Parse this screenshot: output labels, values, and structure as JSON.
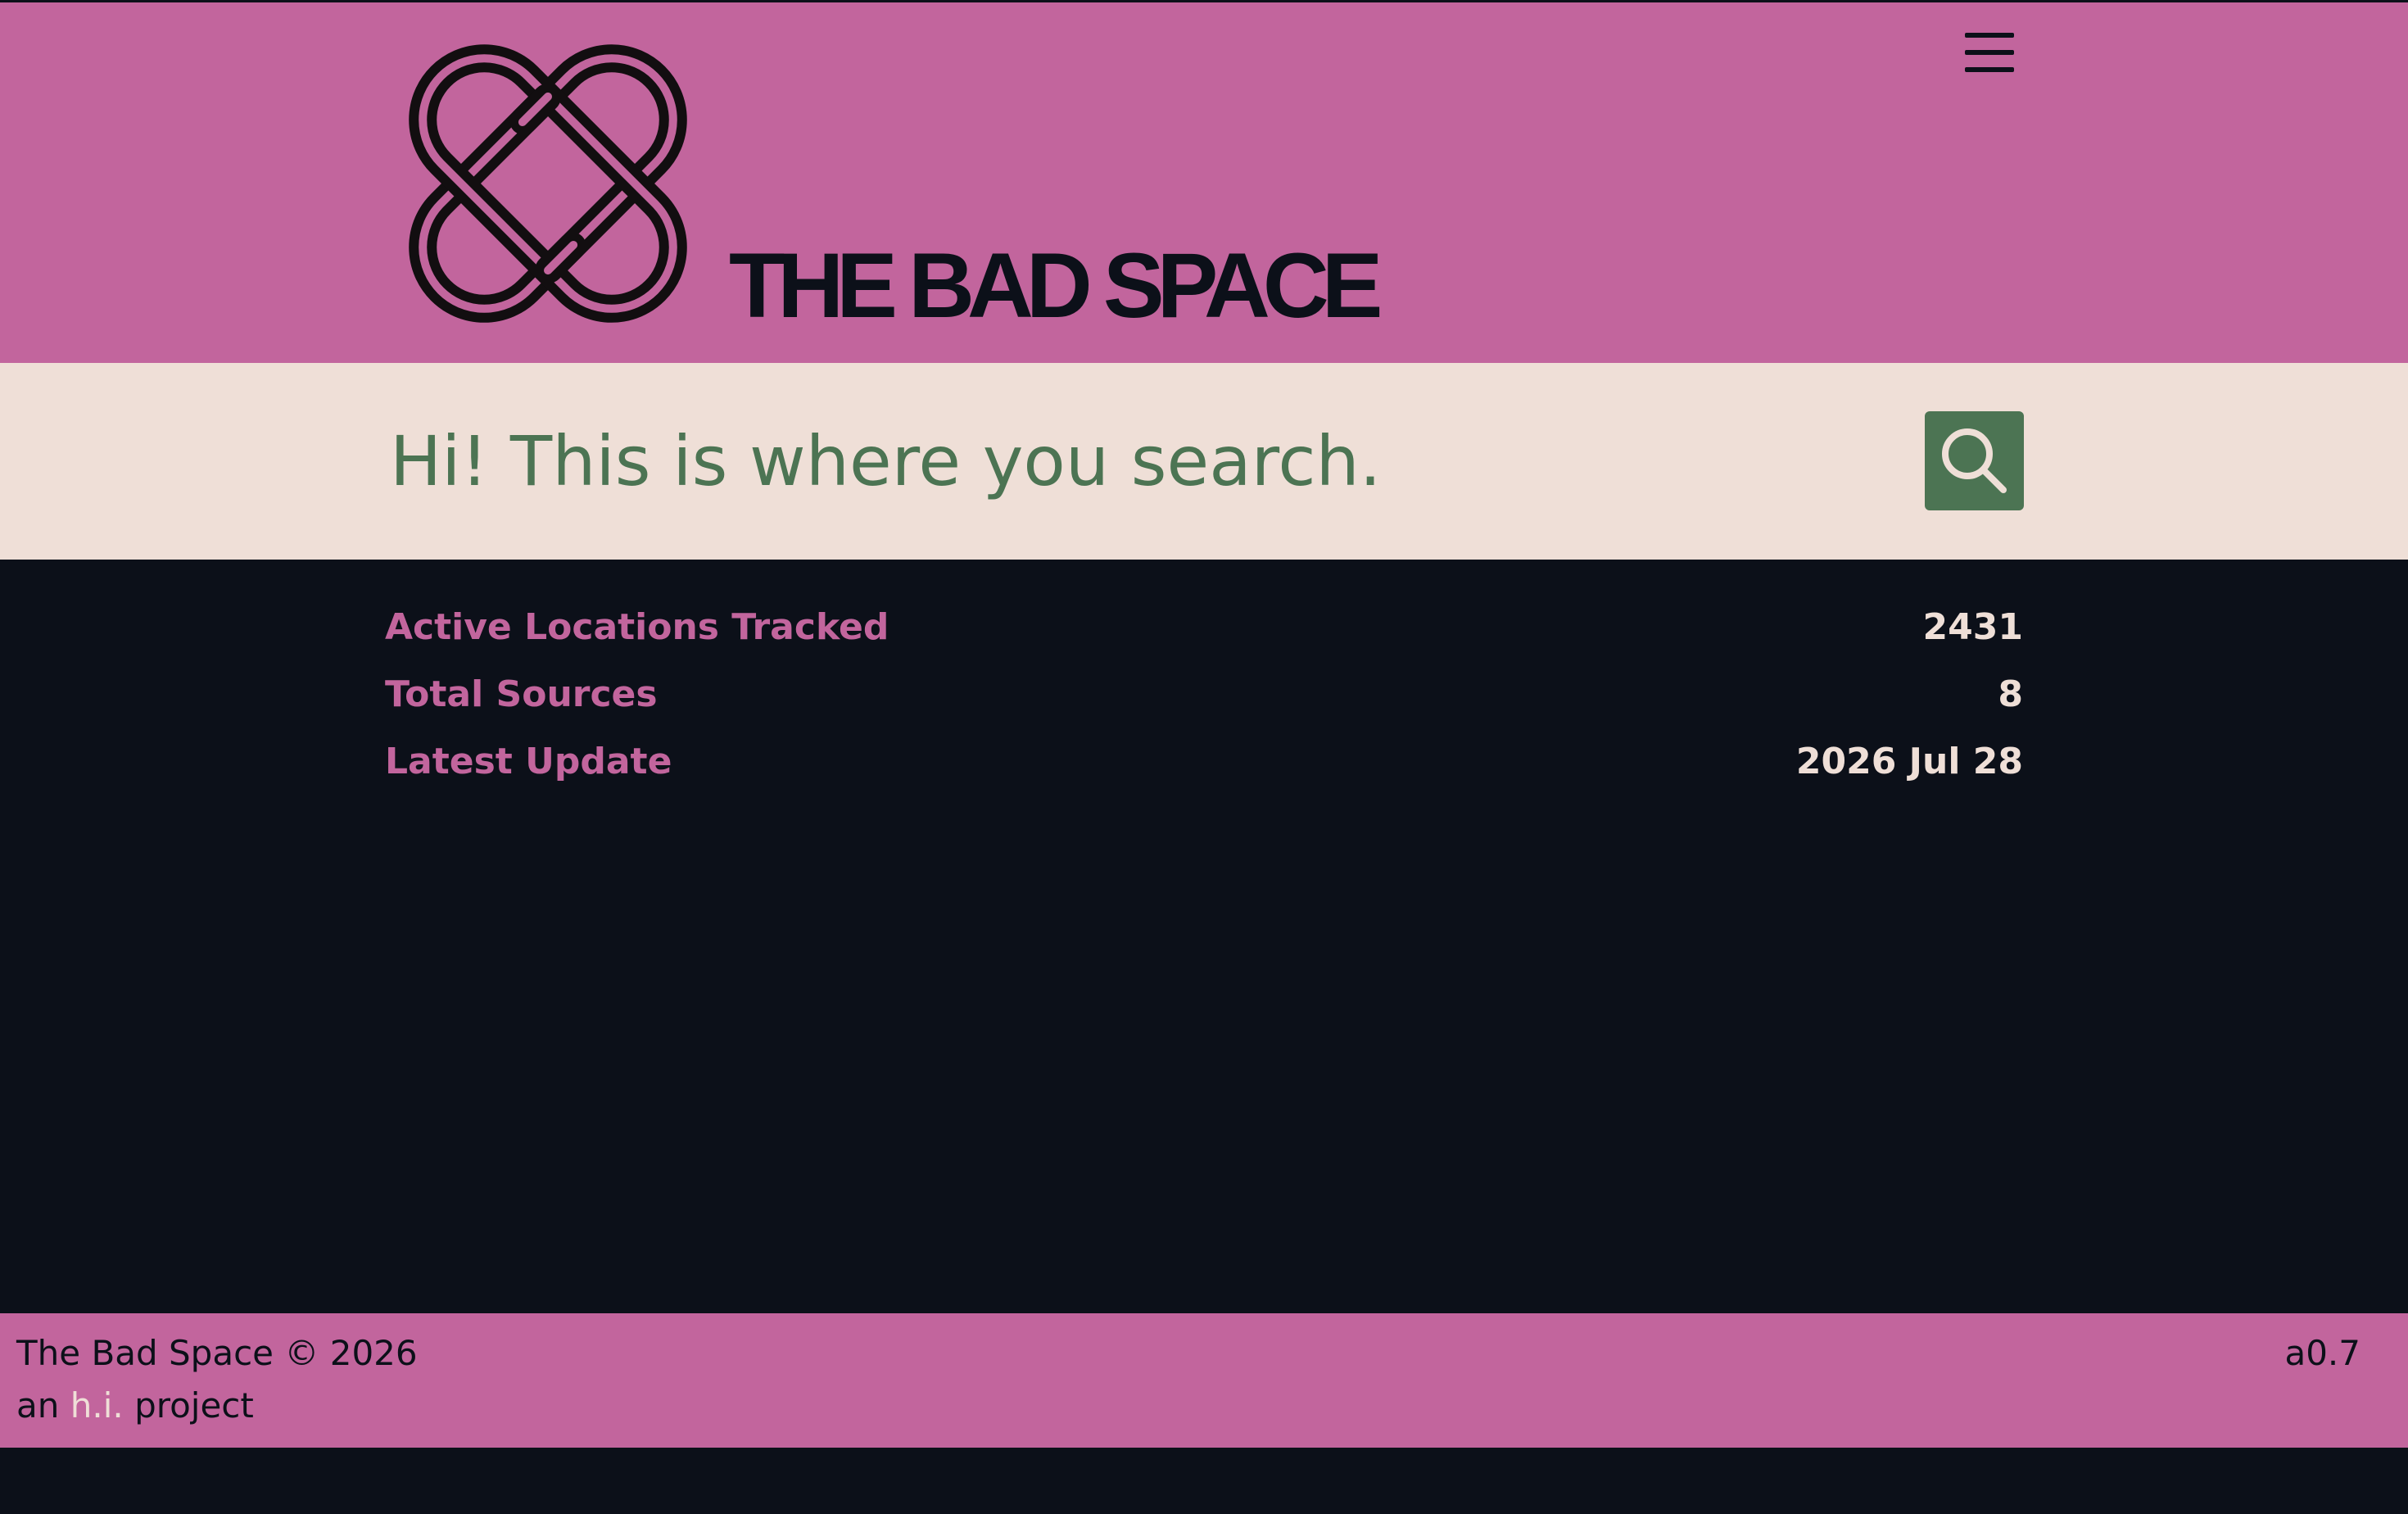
{
  "header": {
    "brand": "THE BAD SPACE",
    "logo_icon": "interlocking-knot-logo",
    "menu_icon": "hamburger-menu-icon"
  },
  "search": {
    "placeholder": "Hi! This is where you search.",
    "value": "",
    "button_icon": "search-icon"
  },
  "stats": [
    {
      "label": "Active Locations Tracked",
      "value": "2431"
    },
    {
      "label": "Total Sources",
      "value": "8"
    },
    {
      "label": "Latest Update",
      "value": "2026 Jul 28"
    }
  ],
  "footer": {
    "copyright": "The Bad Space © 2026",
    "prefix": "an",
    "link_text": "h.i.",
    "suffix": "project",
    "version": "a0.7"
  },
  "colors": {
    "pink": "#c2659d",
    "dark": "#0c1019",
    "cream": "#efdfd7",
    "green": "#4c7453"
  }
}
